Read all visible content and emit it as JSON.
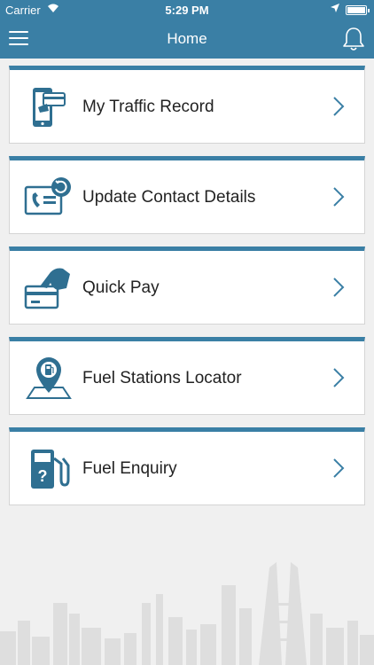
{
  "status_bar": {
    "carrier": "Carrier",
    "time": "5:29 PM"
  },
  "header": {
    "title": "Home"
  },
  "menu": [
    {
      "label": "My Traffic Record",
      "icon": "phone-card-icon"
    },
    {
      "label": "Update Contact Details",
      "icon": "contact-card-icon"
    },
    {
      "label": "Quick Pay",
      "icon": "hand-card-icon"
    },
    {
      "label": "Fuel Stations Locator",
      "icon": "map-pin-fuel-icon"
    },
    {
      "label": "Fuel Enquiry",
      "icon": "fuel-pump-icon"
    }
  ],
  "colors": {
    "accent": "#3a7fa5",
    "background": "#f0f0f0",
    "card": "#ffffff"
  }
}
